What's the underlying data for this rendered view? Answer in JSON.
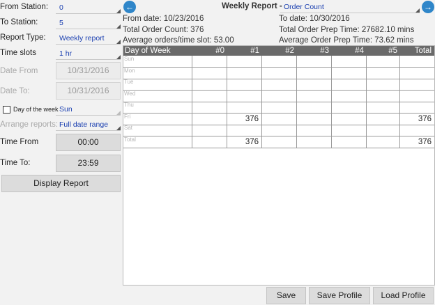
{
  "left": {
    "from_station": {
      "label": "From Station:",
      "value": "0"
    },
    "to_station": {
      "label": "To Station:",
      "value": "5"
    },
    "report_type": {
      "label": "Report Type:",
      "value": "Weekly report"
    },
    "time_slots": {
      "label": "Time slots",
      "value": "1 hr"
    },
    "date_from": {
      "label": "Date From",
      "value": "10/31/2016"
    },
    "date_to": {
      "label": "Date To:",
      "value": "10/31/2016"
    },
    "day_of_week": {
      "label": "Day of the week",
      "value": "Sun",
      "checked": false
    },
    "arrange_reports": {
      "label": "Arrange reports:",
      "value": "Full date range"
    },
    "time_from": {
      "label": "Time From",
      "value": "00:00"
    },
    "time_to": {
      "label": "Time To:",
      "value": "23:59"
    },
    "display_button": "Display Report"
  },
  "header": {
    "title": "Weekly Report -",
    "report_select": "Order Count",
    "prev_icon": "arrow-left-icon",
    "next_icon": "arrow-right-icon",
    "prev_glyph": "←",
    "next_glyph": "→",
    "from_date": "From date: 10/23/2016",
    "to_date": "To date: 10/30/2016",
    "total_count": "Total Order Count: 376",
    "total_prep": "Total Order Prep Time: 27682.10 mins",
    "avg_orders": "Average orders/time slot: 53.00",
    "avg_prep": "Average Order Prep Time: 73.62 mins"
  },
  "table": {
    "headers": [
      "Day of Week",
      "#0",
      "#1",
      "#2",
      "#3",
      "#4",
      "#5",
      "Total"
    ],
    "rows": [
      {
        "day": "Sun",
        "cells": [
          "",
          "",
          "",
          "",
          "",
          "",
          ""
        ]
      },
      {
        "day": "Mon",
        "cells": [
          "",
          "",
          "",
          "",
          "",
          "",
          ""
        ]
      },
      {
        "day": "Tue",
        "cells": [
          "",
          "",
          "",
          "",
          "",
          "",
          ""
        ]
      },
      {
        "day": "Wed",
        "cells": [
          "",
          "",
          "",
          "",
          "",
          "",
          ""
        ]
      },
      {
        "day": "Thu",
        "cells": [
          "",
          "",
          "",
          "",
          "",
          "",
          ""
        ]
      },
      {
        "day": "Fri",
        "cells": [
          "",
          "376",
          "",
          "",
          "",
          "",
          "376"
        ]
      },
      {
        "day": "Sat",
        "cells": [
          "",
          "",
          "",
          "",
          "",
          "",
          ""
        ]
      },
      {
        "day": "Total",
        "cells": [
          "",
          "376",
          "",
          "",
          "",
          "",
          "376"
        ]
      }
    ]
  },
  "footer": {
    "save": "Save",
    "save_profile": "Save Profile",
    "load_profile": "Load Profile"
  }
}
